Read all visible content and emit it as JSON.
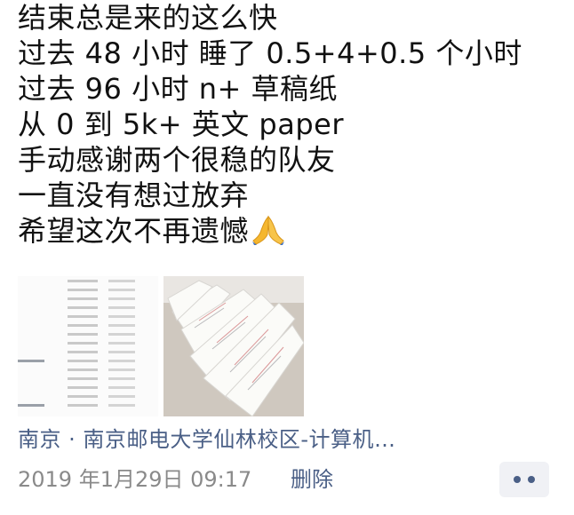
{
  "post": {
    "lines": [
      "结束总是来的这么快",
      "过去 48 小时  睡了 0.5+4+0.5 个小时",
      "过去 96 小时  n+ 草稿纸",
      "从 0 到 5k+ 英文 paper",
      "手动感谢两个很稳的队友",
      "一直没有想过放弃",
      "希望这次不再遗憾"
    ],
    "emoji": "pray-hands-icon"
  },
  "location": "南京 · 南京邮电大学仙林校区-计算机…",
  "timestamp": "2019 年1月29日 09:17",
  "delete_label": "删除",
  "colors": {
    "link": "#4a5f86",
    "meta": "#8a8a8a",
    "text": "#111111"
  }
}
